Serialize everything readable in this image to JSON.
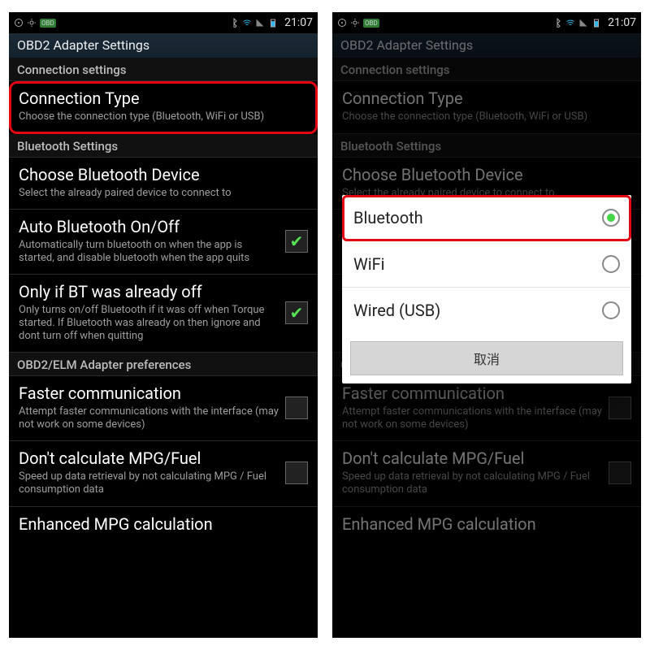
{
  "status": {
    "time": "21:07"
  },
  "appbar": {
    "title": "OBD2 Adapter Settings"
  },
  "sections": {
    "connection": "Connection settings",
    "bluetooth": "Bluetooth Settings",
    "elm": "OBD2/ELM Adapter preferences"
  },
  "rows": {
    "conn_type": {
      "title": "Connection Type",
      "sub": "Choose the connection type (Bluetooth, WiFi or USB)"
    },
    "choose_bt": {
      "title": "Choose Bluetooth Device",
      "sub": "Select the already paired device to connect to"
    },
    "auto_bt": {
      "title": "Auto Bluetooth On/Off",
      "sub": "Automatically turn bluetooth on when the app is started, and disable bluetooth when the app quits"
    },
    "only_off": {
      "title": "Only if BT was already off",
      "sub": "Only turns on/off Bluetooth if it was off when Torque started. If Bluetooth was already on then ignore and dont turn off when quitting"
    },
    "faster": {
      "title": "Faster communication",
      "sub": "Attempt faster communications with the interface (may not work on some devices)"
    },
    "nompg": {
      "title": "Don't calculate MPG/Fuel",
      "sub": "Speed up data retrieval by not calculating MPG / Fuel consumption data"
    },
    "enh": {
      "title": "Enhanced MPG calculation",
      "sub": ""
    }
  },
  "dialog": {
    "options": {
      "bt": "Bluetooth",
      "wifi": "WiFi",
      "usb": "Wired (USB)"
    },
    "cancel": "取消"
  }
}
